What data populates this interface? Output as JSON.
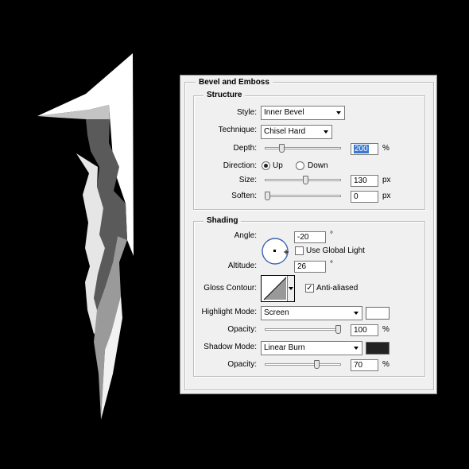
{
  "dialog": {
    "title": "Bevel and Emboss",
    "structure": {
      "legend": "Structure",
      "style_label": "Style:",
      "style_value": "Inner Bevel",
      "technique_label": "Technique:",
      "technique_value": "Chisel Hard",
      "depth_label": "Depth:",
      "depth_value": "200",
      "depth_unit": "%",
      "depth_fraction": 0.2,
      "direction_label": "Direction:",
      "direction_up": "Up",
      "direction_down": "Down",
      "direction_selected": "Up",
      "size_label": "Size:",
      "size_value": "130",
      "size_unit": "px",
      "size_fraction": 0.54,
      "soften_label": "Soften:",
      "soften_value": "0",
      "soften_unit": "px",
      "soften_fraction": 0.0
    },
    "shading": {
      "legend": "Shading",
      "angle_label": "Angle:",
      "angle_value": "-20",
      "angle_unit": "°",
      "use_global_light": "Use Global Light",
      "use_global_light_checked": false,
      "altitude_label": "Altitude:",
      "altitude_value": "26",
      "altitude_unit": "°",
      "gloss_contour_label": "Gloss Contour:",
      "anti_aliased": "Anti-aliased",
      "anti_aliased_checked": true,
      "highlight_mode_label": "Highlight Mode:",
      "highlight_mode_value": "Screen",
      "highlight_color": "#ffffff",
      "highlight_opacity_label": "Opacity:",
      "highlight_opacity_value": "100",
      "highlight_opacity_unit": "%",
      "highlight_opacity_fraction": 1.0,
      "shadow_mode_label": "Shadow Mode:",
      "shadow_mode_value": "Linear Burn",
      "shadow_color": "#222222",
      "shadow_opacity_label": "Opacity:",
      "shadow_opacity_value": "70",
      "shadow_opacity_unit": "%",
      "shadow_opacity_fraction": 0.7
    }
  },
  "colors": {
    "background": "#000000",
    "panel": "#f0f0f0",
    "shape_light": "#ffffff",
    "shape_mid": "#bfbfbf",
    "shape_dark": "#555555"
  }
}
